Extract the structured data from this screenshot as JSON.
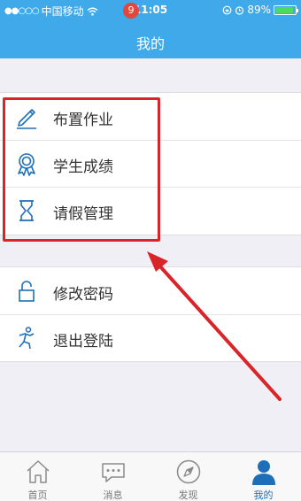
{
  "status_bar": {
    "carrier": "中国移动",
    "time": "11:05",
    "battery": "89%",
    "battery_level": 0.89
  },
  "header": {
    "title": "我的"
  },
  "menu": {
    "group1": [
      {
        "label": "布置作业",
        "icon": "pencil-icon"
      },
      {
        "label": "学生成绩",
        "icon": "award-ribbon-icon"
      },
      {
        "label": "请假管理",
        "icon": "hourglass-icon"
      }
    ],
    "group2": [
      {
        "label": "修改密码",
        "icon": "unlock-icon"
      },
      {
        "label": "退出登陆",
        "icon": "running-person-icon"
      }
    ]
  },
  "tabbar": {
    "tabs": [
      {
        "label": "首页",
        "icon": "home-icon"
      },
      {
        "label": "消息",
        "icon": "chat-bubble-icon",
        "badge": "9"
      },
      {
        "label": "发现",
        "icon": "compass-icon"
      },
      {
        "label": "我的",
        "icon": "person-icon",
        "active": true
      }
    ]
  },
  "colors": {
    "header_bg": "#3fa9e9",
    "icon_blue": "#1d6fb8",
    "highlight_red": "#d9252a",
    "badge_red": "#e4463c"
  }
}
